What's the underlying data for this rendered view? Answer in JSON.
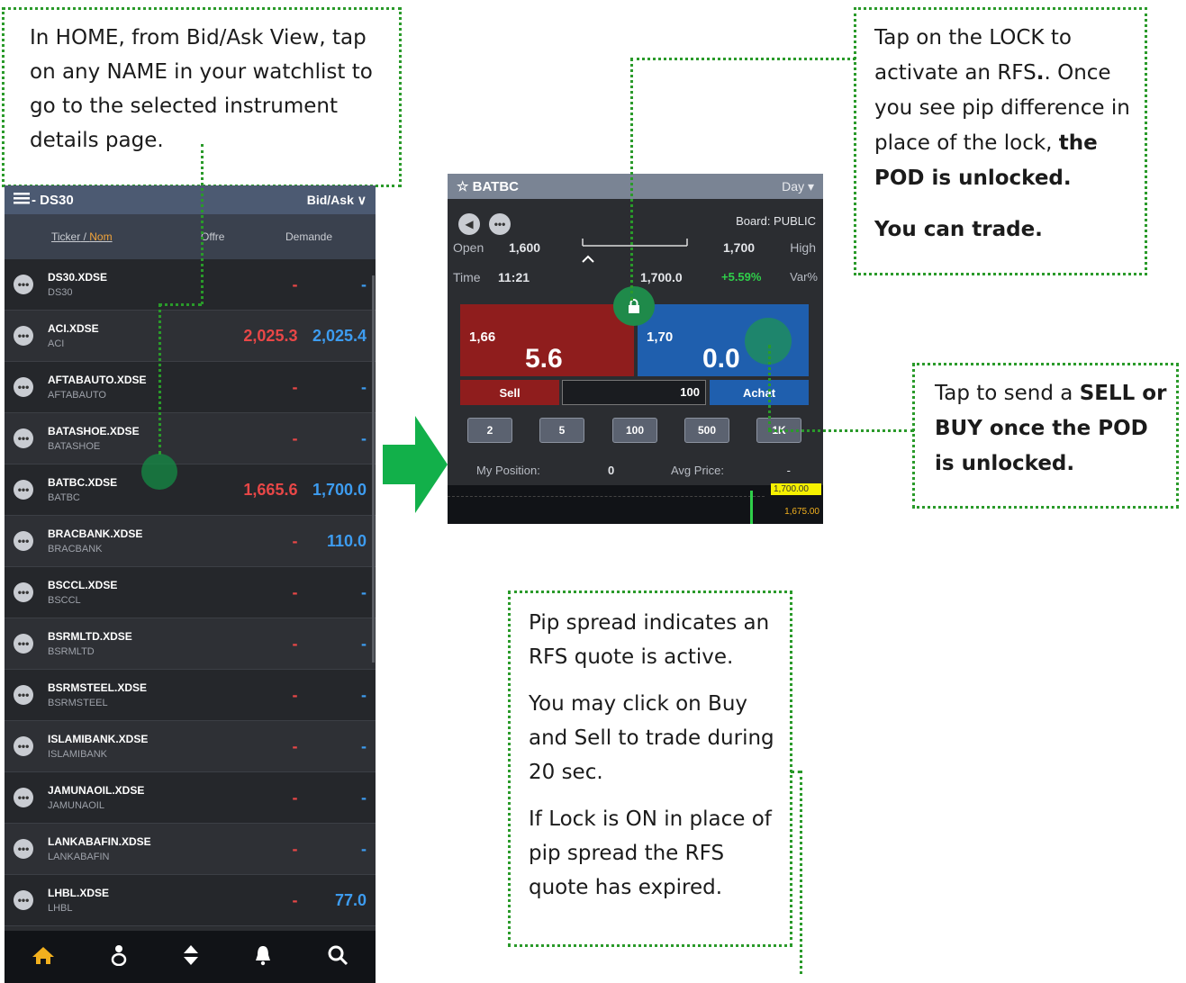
{
  "annotations": {
    "watchlist_tip": "In HOME, from Bid/Ask View, tap on any NAME in your watchlist to go to the selected instrument details page.",
    "lock_tip_1": "Tap on the LOCK to activate an RFS",
    "lock_tip_1b": ". Once you see pip difference in place of the lock, ",
    "lock_tip_1c": "the POD is unlocked.",
    "lock_tip_2": "You can trade.",
    "trade_tip_a": "Tap to send a ",
    "trade_tip_b": "SELL or BUY once the POD is unlocked.",
    "pip_tip_1": "Pip spread indicates an RFS quote is active.",
    "pip_tip_2": "You may click on Buy and Sell to trade during 20 sec.",
    "pip_tip_3": "If Lock is ON in place of pip spread the RFS quote has expired."
  },
  "watchlist": {
    "title": "- DS30",
    "view": "Bid/Ask",
    "col_ticker": "Ticker",
    "col_sep": " / ",
    "col_name": "Nom",
    "col_bid": "Offre",
    "col_ask": "Demande",
    "rows": [
      {
        "ticker": "DS30.XDSE",
        "name": "DS30",
        "bid": "-",
        "ask": "-"
      },
      {
        "ticker": "ACI.XDSE",
        "name": "ACI",
        "bid": "2,025.3",
        "ask": "2,025.4"
      },
      {
        "ticker": "AFTABAUTO.XDSE",
        "name": "AFTABAUTO",
        "bid": "-",
        "ask": "-"
      },
      {
        "ticker": "BATASHOE.XDSE",
        "name": "BATASHOE",
        "bid": "-",
        "ask": "-"
      },
      {
        "ticker": "BATBC.XDSE",
        "name": "BATBC",
        "bid": "1,665.6",
        "ask": "1,700.0"
      },
      {
        "ticker": "BRACBANK.XDSE",
        "name": "BRACBANK",
        "bid": "-",
        "ask": "110.0"
      },
      {
        "ticker": "BSCCL.XDSE",
        "name": "BSCCL",
        "bid": "-",
        "ask": "-"
      },
      {
        "ticker": "BSRMLTD.XDSE",
        "name": "BSRMLTD",
        "bid": "-",
        "ask": "-"
      },
      {
        "ticker": "BSRMSTEEL.XDSE",
        "name": "BSRMSTEEL",
        "bid": "-",
        "ask": "-"
      },
      {
        "ticker": "ISLAMIBANK.XDSE",
        "name": "ISLAMIBANK",
        "bid": "-",
        "ask": "-"
      },
      {
        "ticker": "JAMUNAOIL.XDSE",
        "name": "JAMUNAOIL",
        "bid": "-",
        "ask": "-"
      },
      {
        "ticker": "LANKABAFIN.XDSE",
        "name": "LANKABAFIN",
        "bid": "-",
        "ask": "-"
      },
      {
        "ticker": "LHBL.XDSE",
        "name": "LHBL",
        "bid": "-",
        "ask": "77.0"
      }
    ]
  },
  "detail": {
    "title": "☆ BATBC",
    "period": "Day",
    "board": "Board: PUBLIC",
    "open_label": "Open",
    "open_value": "1,600",
    "high_value": "1,700",
    "high_label": "High",
    "time_label": "Time",
    "time_value": "11:21",
    "last": "1,700.0",
    "var": "+5.59%",
    "var_label": "Var%",
    "sell_small": "1,66",
    "sell_big": "5.6",
    "buy_small": "1,70",
    "buy_big": "0.0",
    "sell_label": "Sell",
    "qty": "100",
    "buy_label": "Achat",
    "quick": [
      "2",
      "5",
      "100",
      "500",
      "1K"
    ],
    "my_position_label": "My Position:",
    "my_position": "0",
    "avg_price_label": "Avg Price:",
    "avg_price": "-",
    "chart_tag_1": "1,700.00",
    "chart_tag_2": "1,675.00"
  },
  "colors": {
    "accent": "#2a9a2a",
    "sell": "#8f1d1d",
    "buy": "#1f5fae",
    "arrow": "#12b04a"
  }
}
